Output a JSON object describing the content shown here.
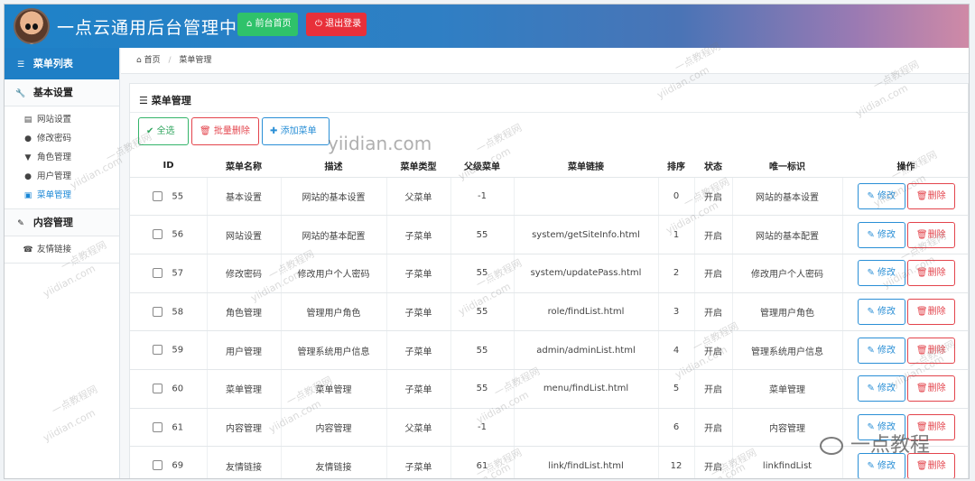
{
  "header": {
    "title": "一点云通用后台管理中心",
    "home_button": "前台首页",
    "logout_button": "退出登录"
  },
  "sidebar": {
    "title": "菜单列表",
    "groups": [
      {
        "label": "基本设置",
        "items": [
          "网站设置",
          "修改密码",
          "角色管理",
          "用户管理",
          "菜单管理"
        ]
      },
      {
        "label": "内容管理",
        "items": [
          "友情链接"
        ]
      }
    ],
    "active_item": "菜单管理"
  },
  "breadcrumb": {
    "home": "首页",
    "current": "菜单管理"
  },
  "panel": {
    "title": "菜单管理",
    "buttons": {
      "select_all": "全选",
      "batch_delete": "批量删除",
      "add_menu": "添加菜单"
    }
  },
  "table": {
    "columns": [
      "ID",
      "菜单名称",
      "描述",
      "菜单类型",
      "父级菜单",
      "菜单链接",
      "排序",
      "状态",
      "唯一标识",
      "操作"
    ],
    "rows": [
      [
        "55",
        "基本设置",
        "网站的基本设置",
        "父菜单",
        "-1",
        "",
        "0",
        "开启",
        "网站的基本设置"
      ],
      [
        "56",
        "网站设置",
        "网站的基本配置",
        "子菜单",
        "55",
        "system/getSiteInfo.html",
        "1",
        "开启",
        "网站的基本配置"
      ],
      [
        "57",
        "修改密码",
        "修改用户个人密码",
        "子菜单",
        "55",
        "system/updatePass.html",
        "2",
        "开启",
        "修改用户个人密码"
      ],
      [
        "58",
        "角色管理",
        "管理用户角色",
        "子菜单",
        "55",
        "role/findList.html",
        "3",
        "开启",
        "管理用户角色"
      ],
      [
        "59",
        "用户管理",
        "管理系统用户信息",
        "子菜单",
        "55",
        "admin/adminList.html",
        "4",
        "开启",
        "管理系统用户信息"
      ],
      [
        "60",
        "菜单管理",
        "菜单管理",
        "子菜单",
        "55",
        "menu/findList.html",
        "5",
        "开启",
        "菜单管理"
      ],
      [
        "61",
        "内容管理",
        "内容管理",
        "父菜单",
        "-1",
        "",
        "6",
        "开启",
        "内容管理"
      ],
      [
        "69",
        "友情链接",
        "友情链接",
        "子菜单",
        "61",
        "link/findList.html",
        "12",
        "开启",
        "linkfindList"
      ]
    ],
    "edit_label": "修改",
    "delete_label": "删除"
  },
  "watermark": {
    "site": "yiidian.com",
    "cn": "一点教程网",
    "wechat": "一点教程"
  },
  "colors": {
    "header_start": "#1e82c8",
    "home_button": "#2fc26a",
    "logout_button": "#e8303a",
    "accent": "#2a8fd6",
    "danger": "#e3444c",
    "success": "#34b46a"
  },
  "icons": {
    "home": "home-icon",
    "logout": "power-icon",
    "list": "list-icon",
    "wrench": "wrench-icon",
    "edit": "pencil-icon",
    "delete": "trash-icon",
    "check": "check-icon"
  }
}
